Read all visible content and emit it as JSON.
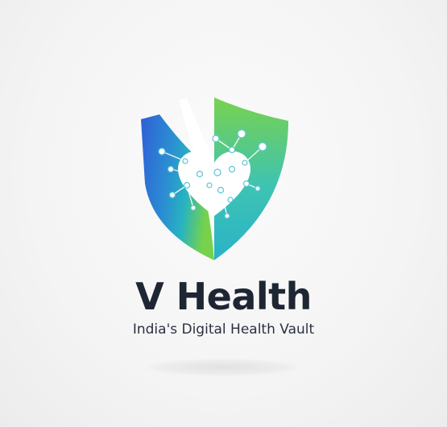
{
  "brand": {
    "name": "V Health",
    "tagline": "India's Digital Health Vault",
    "logo_icon": "shield-heart-network-icon"
  },
  "colors": {
    "background": "#f4f4f4",
    "text_dark": "#1e2633",
    "shield_blue": "#2f5fd6",
    "shield_teal": "#27b3c0",
    "shield_green": "#6fd04f",
    "heart": "#ffffff"
  }
}
